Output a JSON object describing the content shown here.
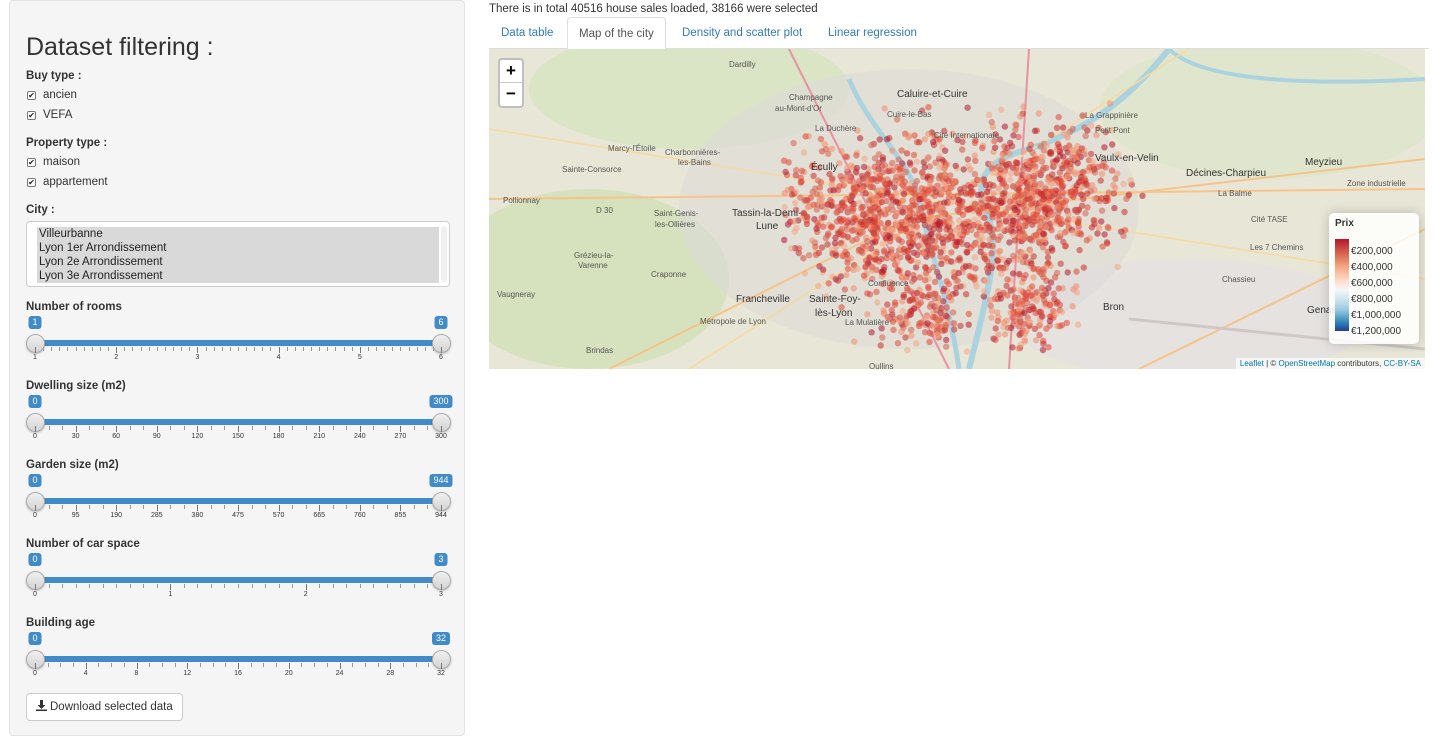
{
  "sidebar": {
    "title": "Dataset filtering :",
    "buy_type": {
      "label": "Buy type :",
      "options": [
        "ancien",
        "VEFA"
      ]
    },
    "property_type": {
      "label": "Property type :",
      "options": [
        "maison",
        "appartement"
      ]
    },
    "city": {
      "label": "City :",
      "options": [
        "Villeurbanne",
        "Lyon 1er Arrondissement",
        "Lyon 2e Arrondissement",
        "Lyon 3e Arrondissement"
      ]
    },
    "sliders": [
      {
        "title": "Number of rooms",
        "min_value": "1",
        "max_value": "6",
        "ticks": [
          "1",
          "2",
          "3",
          "4",
          "5",
          "6"
        ]
      },
      {
        "title": "Dwelling size (m2)",
        "min_value": "0",
        "max_value": "300",
        "ticks": [
          "0",
          "30",
          "60",
          "90",
          "120",
          "150",
          "180",
          "210",
          "240",
          "270",
          "300"
        ]
      },
      {
        "title": "Garden size (m2)",
        "min_value": "0",
        "max_value": "944",
        "ticks": [
          "0",
          "95",
          "190",
          "285",
          "380",
          "475",
          "570",
          "665",
          "760",
          "855",
          "944"
        ]
      },
      {
        "title": "Number of car space",
        "min_value": "0",
        "max_value": "3",
        "ticks": [
          "0",
          "1",
          "2",
          "3"
        ]
      },
      {
        "title": "Building age",
        "min_value": "0",
        "max_value": "32",
        "ticks": [
          "0",
          "4",
          "8",
          "12",
          "16",
          "20",
          "24",
          "28",
          "32"
        ]
      }
    ],
    "download_label": "Download selected data",
    "check_mark": "✔"
  },
  "status": "There is in total 40516 house sales loaded, 38166 were selected",
  "tabs": [
    "Data table",
    "Map of the city",
    "Density and scatter plot",
    "Linear regression"
  ],
  "map": {
    "zoom_in": "+",
    "zoom_out": "−",
    "legend_title": "Prix",
    "legend_values": [
      "€200,000",
      "€400,000",
      "€600,000",
      "€800,000",
      "€1,000,000",
      "€1,200,000"
    ],
    "attribution_leaflet": "Leaflet",
    "attribution_sep": " | © ",
    "attribution_osm": "OpenStreetMap",
    "attribution_contrib": " contributors, ",
    "attribution_license": "CC-BY-SA",
    "labels": [
      {
        "t": "Caluire-et-Cuire",
        "big": true
      },
      {
        "t": "Écully",
        "big": true
      },
      {
        "t": "Tassin-la-Demi-",
        "big": true
      },
      {
        "t": "Lune",
        "big": true
      },
      {
        "t": "Vaulx-en-Velin",
        "big": true
      },
      {
        "t": "Décines-Charpieu",
        "big": true
      },
      {
        "t": "Meyzieu",
        "big": true
      },
      {
        "t": "Francheville",
        "big": true
      },
      {
        "t": "Sainte-Foy-",
        "big": true
      },
      {
        "t": "lès-Lyon",
        "big": true
      },
      {
        "t": "Bron",
        "big": true
      },
      {
        "t": "Genas",
        "big": true
      },
      {
        "t": "Champagne",
        "big": false
      },
      {
        "t": "au-Mont-d'Or",
        "big": false
      },
      {
        "t": "Dardilly",
        "big": false
      },
      {
        "t": "Cuire-le-Bas",
        "big": false
      },
      {
        "t": "Cité Internationale",
        "big": false
      },
      {
        "t": "La Grappinière",
        "big": false
      },
      {
        "t": "Petit Pont",
        "big": false
      },
      {
        "t": "La Duchère",
        "big": false
      },
      {
        "t": "Marcy-l'Étoile",
        "big": false
      },
      {
        "t": "Charbonnières-",
        "big": false
      },
      {
        "t": "les-Bains",
        "big": false
      },
      {
        "t": "Sainte-Consorce",
        "big": false
      },
      {
        "t": "Pollionnay",
        "big": false
      },
      {
        "t": "Saint-Genis-",
        "big": false
      },
      {
        "t": "les-Ollières",
        "big": false
      },
      {
        "t": "Grézieu-la-",
        "big": false
      },
      {
        "t": "Varenne",
        "big": false
      },
      {
        "t": "Craponne",
        "big": false
      },
      {
        "t": "Vaugneray",
        "big": false
      },
      {
        "t": "Brindas",
        "big": false
      },
      {
        "t": "La Mulatière",
        "big": false
      },
      {
        "t": "Confluence",
        "big": false
      },
      {
        "t": "La Balme",
        "big": false
      },
      {
        "t": "Cité TASE",
        "big": false
      },
      {
        "t": "Les 7 Chemins",
        "big": false
      },
      {
        "t": "Chassieu",
        "big": false
      },
      {
        "t": "Zone industrielle",
        "big": false
      },
      {
        "t": "D 30",
        "big": false
      },
      {
        "t": "Métropole de Lyon",
        "big": false
      },
      {
        "t": "Oullins",
        "big": false
      }
    ]
  }
}
